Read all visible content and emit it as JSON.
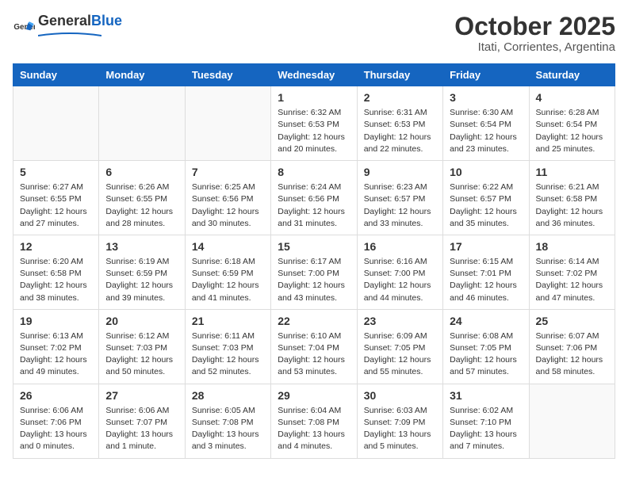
{
  "header": {
    "logo_general": "General",
    "logo_blue": "Blue",
    "title": "October 2025",
    "subtitle": "Itati, Corrientes, Argentina"
  },
  "weekdays": [
    "Sunday",
    "Monday",
    "Tuesday",
    "Wednesday",
    "Thursday",
    "Friday",
    "Saturday"
  ],
  "weeks": [
    [
      {
        "day": "",
        "info": ""
      },
      {
        "day": "",
        "info": ""
      },
      {
        "day": "",
        "info": ""
      },
      {
        "day": "1",
        "info": "Sunrise: 6:32 AM\nSunset: 6:53 PM\nDaylight: 12 hours\nand 20 minutes."
      },
      {
        "day": "2",
        "info": "Sunrise: 6:31 AM\nSunset: 6:53 PM\nDaylight: 12 hours\nand 22 minutes."
      },
      {
        "day": "3",
        "info": "Sunrise: 6:30 AM\nSunset: 6:54 PM\nDaylight: 12 hours\nand 23 minutes."
      },
      {
        "day": "4",
        "info": "Sunrise: 6:28 AM\nSunset: 6:54 PM\nDaylight: 12 hours\nand 25 minutes."
      }
    ],
    [
      {
        "day": "5",
        "info": "Sunrise: 6:27 AM\nSunset: 6:55 PM\nDaylight: 12 hours\nand 27 minutes."
      },
      {
        "day": "6",
        "info": "Sunrise: 6:26 AM\nSunset: 6:55 PM\nDaylight: 12 hours\nand 28 minutes."
      },
      {
        "day": "7",
        "info": "Sunrise: 6:25 AM\nSunset: 6:56 PM\nDaylight: 12 hours\nand 30 minutes."
      },
      {
        "day": "8",
        "info": "Sunrise: 6:24 AM\nSunset: 6:56 PM\nDaylight: 12 hours\nand 31 minutes."
      },
      {
        "day": "9",
        "info": "Sunrise: 6:23 AM\nSunset: 6:57 PM\nDaylight: 12 hours\nand 33 minutes."
      },
      {
        "day": "10",
        "info": "Sunrise: 6:22 AM\nSunset: 6:57 PM\nDaylight: 12 hours\nand 35 minutes."
      },
      {
        "day": "11",
        "info": "Sunrise: 6:21 AM\nSunset: 6:58 PM\nDaylight: 12 hours\nand 36 minutes."
      }
    ],
    [
      {
        "day": "12",
        "info": "Sunrise: 6:20 AM\nSunset: 6:58 PM\nDaylight: 12 hours\nand 38 minutes."
      },
      {
        "day": "13",
        "info": "Sunrise: 6:19 AM\nSunset: 6:59 PM\nDaylight: 12 hours\nand 39 minutes."
      },
      {
        "day": "14",
        "info": "Sunrise: 6:18 AM\nSunset: 6:59 PM\nDaylight: 12 hours\nand 41 minutes."
      },
      {
        "day": "15",
        "info": "Sunrise: 6:17 AM\nSunset: 7:00 PM\nDaylight: 12 hours\nand 43 minutes."
      },
      {
        "day": "16",
        "info": "Sunrise: 6:16 AM\nSunset: 7:00 PM\nDaylight: 12 hours\nand 44 minutes."
      },
      {
        "day": "17",
        "info": "Sunrise: 6:15 AM\nSunset: 7:01 PM\nDaylight: 12 hours\nand 46 minutes."
      },
      {
        "day": "18",
        "info": "Sunrise: 6:14 AM\nSunset: 7:02 PM\nDaylight: 12 hours\nand 47 minutes."
      }
    ],
    [
      {
        "day": "19",
        "info": "Sunrise: 6:13 AM\nSunset: 7:02 PM\nDaylight: 12 hours\nand 49 minutes."
      },
      {
        "day": "20",
        "info": "Sunrise: 6:12 AM\nSunset: 7:03 PM\nDaylight: 12 hours\nand 50 minutes."
      },
      {
        "day": "21",
        "info": "Sunrise: 6:11 AM\nSunset: 7:03 PM\nDaylight: 12 hours\nand 52 minutes."
      },
      {
        "day": "22",
        "info": "Sunrise: 6:10 AM\nSunset: 7:04 PM\nDaylight: 12 hours\nand 53 minutes."
      },
      {
        "day": "23",
        "info": "Sunrise: 6:09 AM\nSunset: 7:05 PM\nDaylight: 12 hours\nand 55 minutes."
      },
      {
        "day": "24",
        "info": "Sunrise: 6:08 AM\nSunset: 7:05 PM\nDaylight: 12 hours\nand 57 minutes."
      },
      {
        "day": "25",
        "info": "Sunrise: 6:07 AM\nSunset: 7:06 PM\nDaylight: 12 hours\nand 58 minutes."
      }
    ],
    [
      {
        "day": "26",
        "info": "Sunrise: 6:06 AM\nSunset: 7:06 PM\nDaylight: 13 hours\nand 0 minutes."
      },
      {
        "day": "27",
        "info": "Sunrise: 6:06 AM\nSunset: 7:07 PM\nDaylight: 13 hours\nand 1 minute."
      },
      {
        "day": "28",
        "info": "Sunrise: 6:05 AM\nSunset: 7:08 PM\nDaylight: 13 hours\nand 3 minutes."
      },
      {
        "day": "29",
        "info": "Sunrise: 6:04 AM\nSunset: 7:08 PM\nDaylight: 13 hours\nand 4 minutes."
      },
      {
        "day": "30",
        "info": "Sunrise: 6:03 AM\nSunset: 7:09 PM\nDaylight: 13 hours\nand 5 minutes."
      },
      {
        "day": "31",
        "info": "Sunrise: 6:02 AM\nSunset: 7:10 PM\nDaylight: 13 hours\nand 7 minutes."
      },
      {
        "day": "",
        "info": ""
      }
    ]
  ]
}
